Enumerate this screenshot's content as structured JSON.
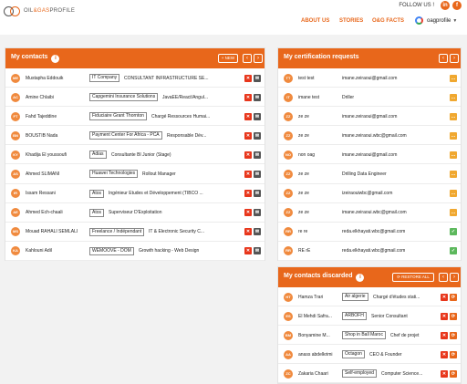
{
  "header": {
    "logo_oil": "OIL",
    "logo_gas": "&GAS",
    "logo_profile": "PROFILE",
    "follow_label": "FOLLOW US !",
    "social_icons": [
      "linkedin-icon",
      "facebook-icon"
    ],
    "nav": [
      "ABOUT US",
      "STORIES",
      "O&G FACTS"
    ],
    "profile_name": "oagprofile"
  },
  "contacts": {
    "title": "My contacts",
    "new_label": "+ NEW",
    "rows": [
      {
        "initials": "ME",
        "name": "Mustapha Eddouik",
        "company": "IT Company",
        "job": "CONSULTANT INFRASTRUCTURE SE..."
      },
      {
        "initials": "AC",
        "name": "Amine Chlaibi",
        "company": "Capgemini Insurance Solutions",
        "job": "JavaEE/React/Angul..."
      },
      {
        "initials": "FT",
        "name": "Fahd Tajeddine",
        "company": "Fiduciaire Grant Thornton",
        "job": "Chargé Ressources Humai..."
      },
      {
        "initials": "BN",
        "name": "BOUSTIB Nada",
        "company": "Payment Center For Africa - PCA",
        "job": "Responsable Dév..."
      },
      {
        "initials": "KY",
        "name": "Khadija El youssoufi",
        "company": "Adias",
        "job": "Consultante BI Junior (Stage)"
      },
      {
        "initials": "AS",
        "name": "Ahmed SLIMANI",
        "company": "Huawei Technologies",
        "job": "Rollout Manager"
      },
      {
        "initials": "IR",
        "name": "Issam Ressani",
        "company": "Atos",
        "job": "Ingénieur Etudes et Développement (TIBCO ..."
      },
      {
        "initials": "AE",
        "name": "Ahmed Ech-chaali",
        "company": "Atos",
        "job": "Superviseur D'Exploitation"
      },
      {
        "initials": "MS",
        "name": "Mouad RAHALI SEMLALI",
        "company": "Freelance / Indépendant",
        "job": "IT & Electronic Security C..."
      },
      {
        "initials": "KA",
        "name": "Kahlouni Adil",
        "company": "WEMOOVE - DOM",
        "job": "Growth hacking - Web Design"
      }
    ]
  },
  "certifications": {
    "title": "My certification requests",
    "rows": [
      {
        "initials": "TT",
        "name": "test test",
        "detail": "imane.zeiraoui@gmail.com",
        "status": "pending"
      },
      {
        "initials": "IT",
        "name": "imane test",
        "detail": "Driller",
        "status": "pending"
      },
      {
        "initials": "ZZ",
        "name": "ze ze",
        "detail": "imane.zeiraoui@gmail.com",
        "status": "pending"
      },
      {
        "initials": "ZZ",
        "name": "ze ze",
        "detail": "imane.zeiraoui.wbc@gmail.com",
        "status": "pending"
      },
      {
        "initials": "NO",
        "name": "non oag",
        "detail": "imane.zeiraoui@gmail.com",
        "status": "pending"
      },
      {
        "initials": "ZZ",
        "name": "ze ze",
        "detail": "Drilling Data Engineer",
        "status": "pending"
      },
      {
        "initials": "ZZ",
        "name": "ze ze",
        "detail": "izeiraouiwbc@gmail.com",
        "status": "pending"
      },
      {
        "initials": "ZZ",
        "name": "ze ze",
        "detail": "imane.zeiraoui.wbc@gmail.com",
        "status": "pending"
      },
      {
        "initials": "RR",
        "name": "re re",
        "detail": "reda.elkhayati.wbc@gmail.com",
        "status": "accepted"
      },
      {
        "initials": "RR",
        "name": "RE rE",
        "detail": "reda.elkhayati.wbc@gmail.com",
        "status": "accepted"
      }
    ]
  },
  "discarded": {
    "title": "My contacts discarded",
    "restore_label": "⟳ RESTORE ALL",
    "rows": [
      {
        "initials": "HT",
        "name": "Hamza Trari",
        "company": "Air algerie",
        "job": "Chargé d'études stati..."
      },
      {
        "initials": "ES",
        "name": "El Mehdi Safra...",
        "company": "ARBOFH",
        "job": "Senior Consultant"
      },
      {
        "initials": "BM",
        "name": "Bonyamine M...",
        "company": "Shop in Ball Maroc",
        "job": "Chef de projet"
      },
      {
        "initials": "AA",
        "name": "anass abdelkrimi",
        "company": "Octagon",
        "job": "CEO & Founder"
      },
      {
        "initials": "ZC",
        "name": "Zakaria Chaari",
        "company": "Self-employed",
        "job": "Computer Science..."
      }
    ]
  },
  "colors": {
    "accent": "#e8671b",
    "avatar": "#f08a3e",
    "delete": "#e8361b",
    "pending": "#f0a830",
    "accepted": "#5cb85c"
  }
}
